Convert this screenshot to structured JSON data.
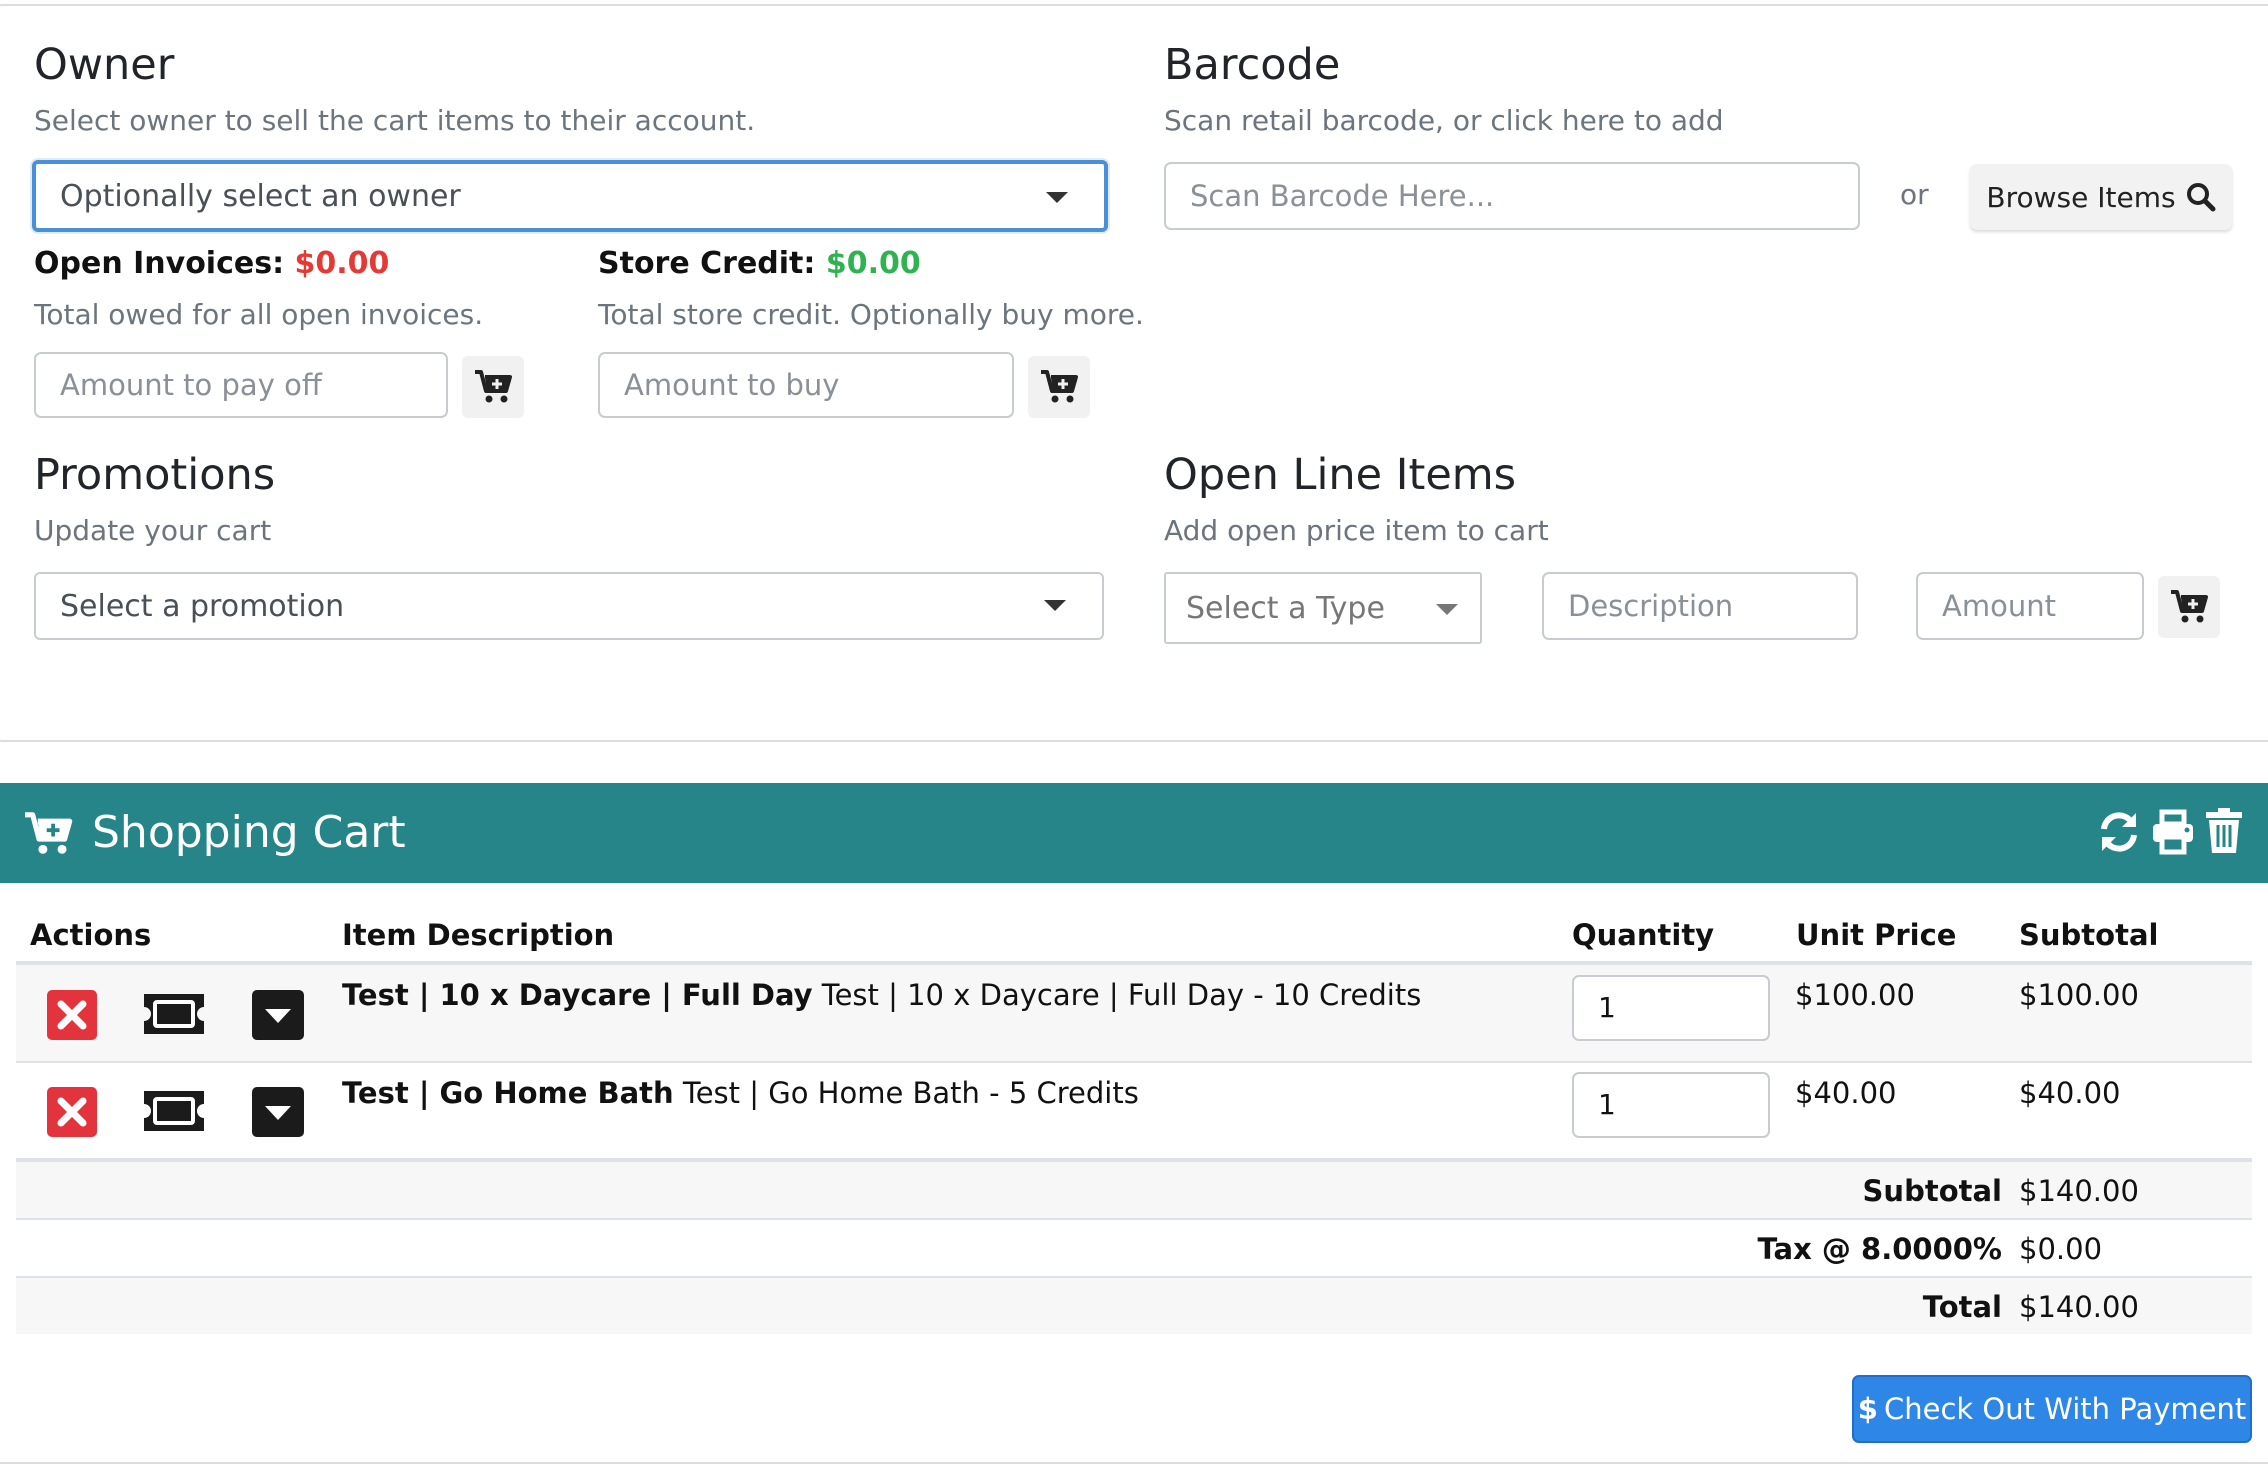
{
  "owner": {
    "title": "Owner",
    "subtitle": "Select owner to sell the cart items to their account.",
    "select_value": "Optionally select an owner"
  },
  "open_invoices": {
    "label": "Open Invoices:",
    "amount": "$0.00",
    "help": "Total owed for all open invoices.",
    "input_placeholder": "Amount to pay off"
  },
  "store_credit": {
    "label": "Store Credit:",
    "amount": "$0.00",
    "help": "Total store credit. Optionally buy more.",
    "input_placeholder": "Amount to buy"
  },
  "barcode": {
    "title": "Barcode",
    "subtitle": "Scan retail barcode, or click here to add",
    "input_placeholder": "Scan Barcode Here...",
    "or_text": "or",
    "browse_label": "Browse Items"
  },
  "promotions": {
    "title": "Promotions",
    "subtitle": "Update your cart",
    "select_value": "Select a promotion"
  },
  "open_line_items": {
    "title": "Open Line Items",
    "subtitle": "Add open price item to cart",
    "type_select": "Select a Type",
    "description_placeholder": "Description",
    "amount_placeholder": "Amount"
  },
  "cart": {
    "title": "Shopping Cart",
    "columns": {
      "actions": "Actions",
      "description": "Item Description",
      "quantity": "Quantity",
      "unit_price": "Unit Price",
      "subtotal": "Subtotal"
    },
    "rows": [
      {
        "name_bold": "Test | 10 x Daycare | Full Day",
        "detail": " Test | 10 x Daycare | Full Day - 10 Credits",
        "quantity": "1",
        "unit_price": "$100.00",
        "subtotal": "$100.00"
      },
      {
        "name_bold": "Test | Go Home Bath",
        "detail": " Test | Go Home Bath - 5 Credits",
        "quantity": "1",
        "unit_price": "$40.00",
        "subtotal": "$40.00"
      }
    ],
    "summary": {
      "subtotal_label": "Subtotal",
      "subtotal_value": "$140.00",
      "tax_label": "Tax @ 8.0000%",
      "tax_value": "$0.00",
      "total_label": "Total",
      "total_value": "$140.00"
    },
    "checkout_label": "Check Out With Payment"
  },
  "colors": {
    "cart_header": "#268588",
    "primary": "#2e86e6",
    "danger": "#e3343d",
    "success": "#2fb351",
    "focus": "#4a90d9"
  },
  "icons": [
    "cart-plus-icon",
    "search-icon",
    "sync-icon",
    "print-icon",
    "trash-icon",
    "close-icon",
    "ticket-icon",
    "caret-down-icon",
    "dollar-icon"
  ]
}
